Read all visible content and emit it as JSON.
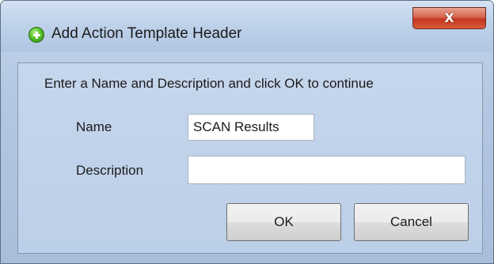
{
  "window": {
    "title": "Add Action Template Header",
    "close_label": "X"
  },
  "dialog": {
    "instruction": "Enter a Name and Description and click OK to continue",
    "name_label": "Name",
    "name_value": "SCAN Results",
    "description_label": "Description",
    "description_value": ""
  },
  "buttons": {
    "ok_label": "OK",
    "cancel_label": "Cancel"
  },
  "icons": {
    "app_icon": "green-plus-icon",
    "close_icon": "close-icon"
  },
  "colors": {
    "frame": "#b3c7e2",
    "close_button": "#c4381f"
  }
}
